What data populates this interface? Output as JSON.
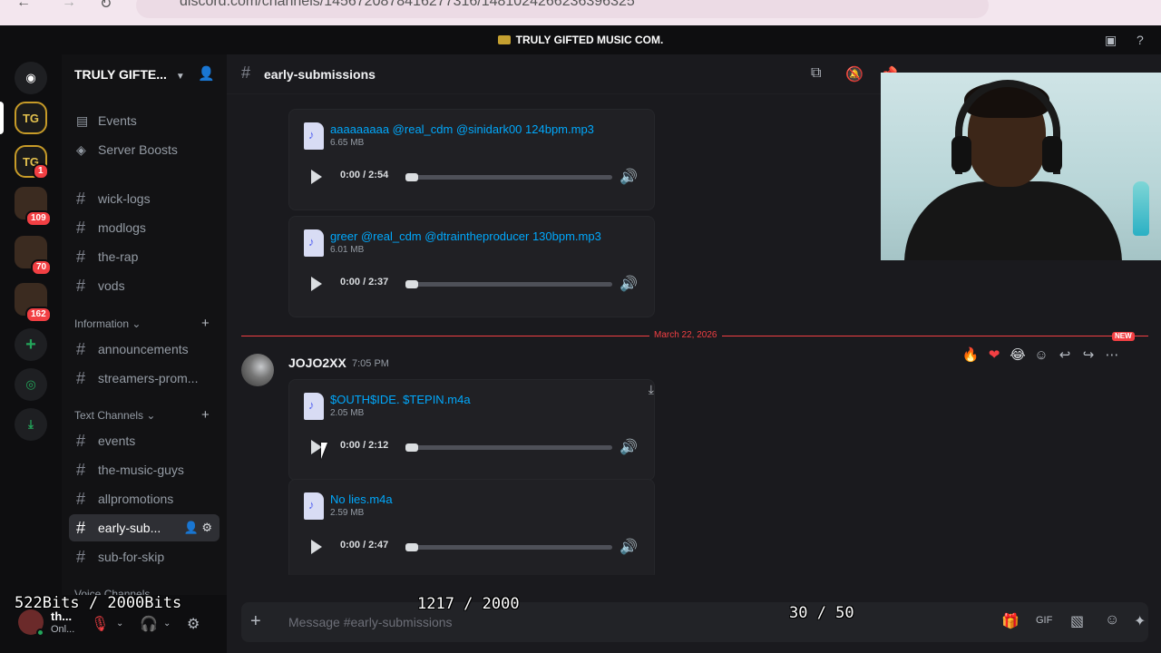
{
  "browser": {
    "url": "discord.com/channels/1456720878416277316/1481024266236396325"
  },
  "window": {
    "title": "TRULY GIFTED MUSIC COM."
  },
  "rail": {
    "servers": [
      {
        "label": "TG",
        "kind": "server"
      },
      {
        "label": "TG",
        "kind": "server",
        "badge": "1"
      },
      {
        "kind": "folder",
        "badge": "109"
      },
      {
        "kind": "folder",
        "badge": "70"
      },
      {
        "kind": "folder",
        "badge": "162"
      }
    ]
  },
  "sidebar": {
    "server_name": "TRULY GIFTE...",
    "top_items": [
      {
        "label": "Events",
        "icon": "calendar-icon"
      },
      {
        "label": "Server Boosts",
        "icon": "boost-icon"
      }
    ],
    "channels_a": [
      "wick-logs",
      "modlogs",
      "the-rap",
      "vods"
    ],
    "category_info": "Information",
    "channels_info": [
      "announcements",
      "streamers-prom..."
    ],
    "category_text": "Text Channels",
    "channels_text": [
      "events",
      "the-music-guys",
      "allpromotions",
      "early-sub...",
      "sub-for-skip"
    ],
    "category_voice": "Voice Channels"
  },
  "user": {
    "name": "th...",
    "status": "Onl..."
  },
  "channel": {
    "name": "early-submissions"
  },
  "messages": {
    "attachments_prev": [
      {
        "filename": "aaaaaaaaa @real_cdm @sinidark00 124bpm.mp3",
        "size": "6.65 MB",
        "time": "0:00 / 2:54"
      },
      {
        "filename": "greer @real_cdm @dtraintheproducer 130bpm.mp3",
        "size": "6.01 MB",
        "time": "0:00 / 2:37"
      }
    ],
    "divider_date": "March 22, 2026",
    "new_label": "NEW",
    "author": "JOJO2XX",
    "timestamp": "7:05 PM",
    "attachments": [
      {
        "filename": "$OUTH$IDE. $TEPIN.m4a",
        "size": "2.05 MB",
        "time": "0:00 / 2:12"
      },
      {
        "filename": "No lies.m4a",
        "size": "2.59 MB",
        "time": "0:00 / 2:47"
      }
    ]
  },
  "composer": {
    "placeholder": "Message #early-submissions"
  },
  "overlays": {
    "bits": "522Bits / 2000Bits",
    "count1": "1217 / 2000",
    "count2": "30 / 50"
  },
  "colors": {
    "accent": "#5865f2",
    "link": "#00a8fc",
    "danger": "#f23f43",
    "online": "#23a55a"
  }
}
